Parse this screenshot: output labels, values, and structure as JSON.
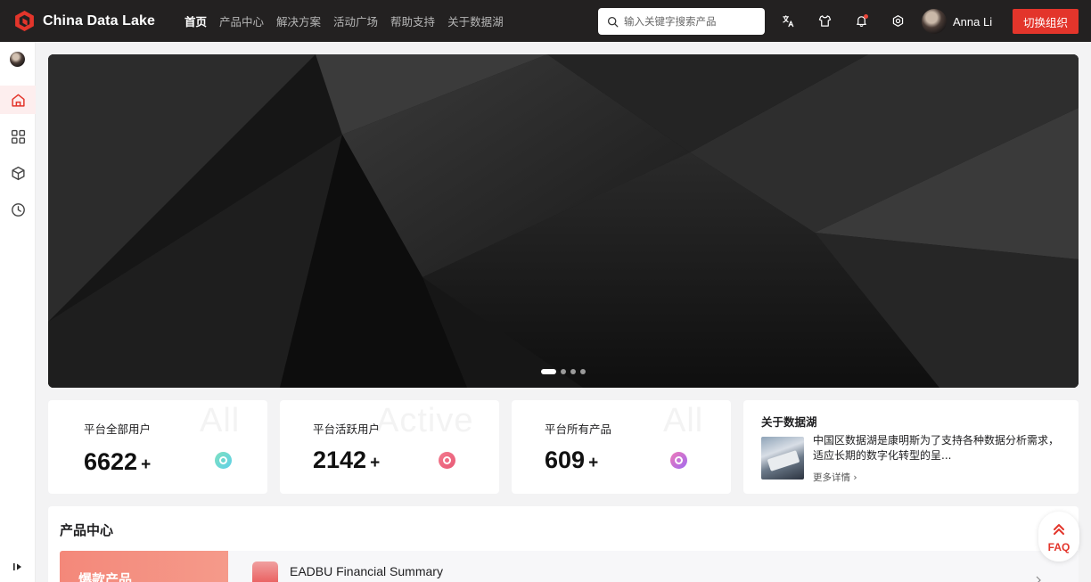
{
  "app": {
    "title": "China Data Lake"
  },
  "nav": [
    {
      "label": "首页",
      "active": true
    },
    {
      "label": "产品中心",
      "active": false
    },
    {
      "label": "解决方案",
      "active": false
    },
    {
      "label": "活动广场",
      "active": false
    },
    {
      "label": "帮助支持",
      "active": false
    },
    {
      "label": "关于数据湖",
      "active": false
    }
  ],
  "search": {
    "placeholder": "输入关键字搜索产品",
    "value": ""
  },
  "topbar_icons": [
    "translate-icon",
    "shirt-icon",
    "bell-icon",
    "settings-icon"
  ],
  "user": {
    "name": "Anna Li"
  },
  "switch_org": {
    "label": "切换组织"
  },
  "sidebar": {
    "items": [
      "home-icon",
      "grid-icon",
      "cube-icon",
      "clock-icon"
    ],
    "active_index": 0
  },
  "banner": {
    "slide_count": 4,
    "active_slide": 0
  },
  "stats": [
    {
      "watermark": "All",
      "label": "平台全部用户",
      "value": "6622",
      "suffix": "+",
      "color": "green"
    },
    {
      "watermark": "Active",
      "label": "平台活跃用户",
      "value": "2142",
      "suffix": "+",
      "color": "pink"
    },
    {
      "watermark": "All",
      "label": "平台所有产品",
      "value": "609",
      "suffix": "+",
      "color": "purple"
    }
  ],
  "about": {
    "title": "关于数据湖",
    "description": "中国区数据湖是康明斯为了支持各种数据分析需求，适应长期的数字化转型的呈...",
    "more": "更多详情"
  },
  "products": {
    "title": "产品中心",
    "hot_tab": "爆款产品",
    "items": [
      {
        "name": "EADBU Financial Summary"
      }
    ]
  },
  "faq": {
    "label": "FAQ"
  },
  "colors": {
    "brand": "#e3352b",
    "topbar": "#232121"
  }
}
